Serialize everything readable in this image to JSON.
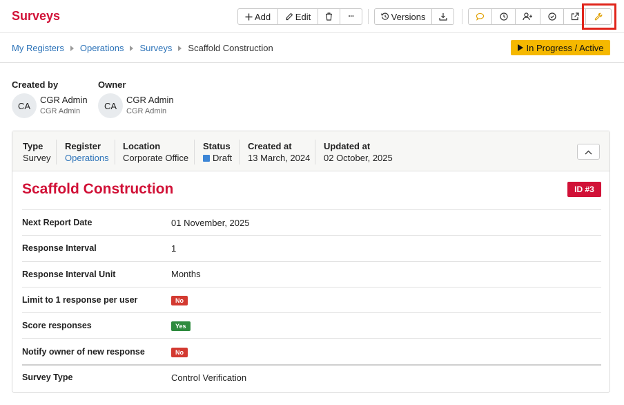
{
  "header": {
    "title": "Surveys",
    "add_label": "Add",
    "edit_label": "Edit",
    "versions_label": "Versions",
    "more_label": "···",
    "icons": [
      "plus-icon",
      "pencil-icon",
      "trash-icon",
      "ellipsis-icon",
      "history-icon",
      "download-icon",
      "comment-icon",
      "clock-icon",
      "add-user-icon",
      "check-circle-icon",
      "external-link-icon",
      "wrench-icon"
    ],
    "highlight_color": "#e0251b",
    "accent": "#d11137"
  },
  "breadcrumb": {
    "items": [
      "My Registers",
      "Operations",
      "Surveys"
    ],
    "current": "Scaffold Construction"
  },
  "status": {
    "label": "In Progress / Active",
    "color": "#f5b800"
  },
  "people": {
    "created_by": {
      "heading": "Created by",
      "initials": "CA",
      "name": "CGR Admin",
      "sub": "CGR Admin"
    },
    "owner": {
      "heading": "Owner",
      "initials": "CA",
      "name": "CGR Admin",
      "sub": "CGR Admin"
    }
  },
  "meta": {
    "type": {
      "label": "Type",
      "value": "Survey"
    },
    "register": {
      "label": "Register",
      "value": "Operations"
    },
    "location": {
      "label": "Location",
      "value": "Corporate Office"
    },
    "status": {
      "label": "Status",
      "value": "Draft",
      "color": "#3d86d6"
    },
    "created_at": {
      "label": "Created at",
      "value": "13 March, 2024"
    },
    "updated_at": {
      "label": "Updated at",
      "value": "02 October, 2025"
    }
  },
  "record": {
    "title": "Scaffold Construction",
    "id_badge": "ID #3"
  },
  "fields": [
    {
      "label": "Next Report Date",
      "value": "01 November, 2025"
    },
    {
      "label": "Response Interval",
      "value": "1"
    },
    {
      "label": "Response Interval Unit",
      "value": "Months"
    },
    {
      "label": "Limit to 1 response per user",
      "value": "No"
    },
    {
      "label": "Score responses",
      "value": "Yes"
    },
    {
      "label": "Notify owner of new response",
      "value": "No"
    },
    {
      "label": "Survey Type",
      "value": "Control Verification"
    }
  ]
}
